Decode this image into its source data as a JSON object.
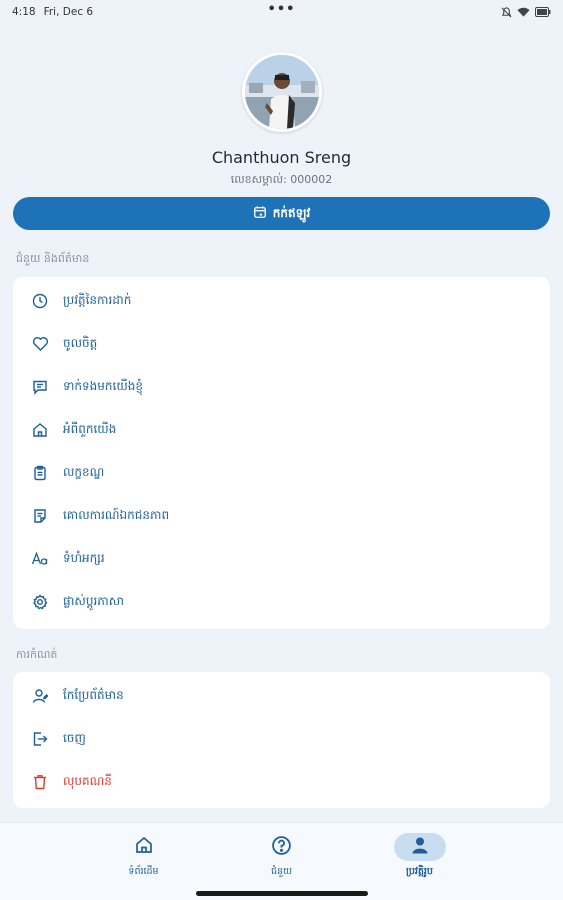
{
  "status_bar": {
    "time": "4:18",
    "date": "Fri, Dec 6",
    "center_dots": "•••"
  },
  "profile": {
    "name": "Chanthuon Sreng",
    "id_text": "លេខសម្គាល់: 000002"
  },
  "book_button": {
    "label": "កក់ឥឡូវ"
  },
  "sections": {
    "general": {
      "label": "ជំនួយ និងព័ត៌មាន",
      "items": [
        {
          "label": "ប្រវត្តិនៃការដាក់",
          "icon": "clock-icon"
        },
        {
          "label": "ចូលចិត្ត",
          "icon": "heart-icon"
        },
        {
          "label": "ទាក់ទងមកយើងខ្ញុំ",
          "icon": "chat-icon"
        },
        {
          "label": "អំពីពួកយើង",
          "icon": "home-icon"
        },
        {
          "label": "លក្ខខណ្ឌ",
          "icon": "clipboard-icon"
        },
        {
          "label": "គោលការណ៍ឯកជនភាព",
          "icon": "document-icon"
        },
        {
          "label": "ទំហំអក្សរ",
          "icon": "font-size-icon"
        },
        {
          "label": "ផ្លាស់ប្តូរភាសា",
          "icon": "settings-icon"
        }
      ]
    },
    "account": {
      "label": "ការកំណត់",
      "items": [
        {
          "label": "កែប្រែព័ត៌មាន",
          "icon": "user-icon",
          "danger": false
        },
        {
          "label": "ចេញ",
          "icon": "logout-icon",
          "danger": false
        },
        {
          "label": "លុបគណនី",
          "icon": "trash-icon",
          "danger": true
        }
      ]
    }
  },
  "bottom_nav": {
    "items": [
      {
        "label": "ទំព័រដើម",
        "icon": "home-icon"
      },
      {
        "label": "ជំនួយ",
        "icon": "help-icon"
      },
      {
        "label": "ប្រវត្តិរូប",
        "icon": "person-icon",
        "active": true
      }
    ]
  },
  "colors": {
    "primary": "#1e72b8",
    "link": "#1e5f99",
    "danger": "#e0382f",
    "background": "#eef3fa"
  }
}
